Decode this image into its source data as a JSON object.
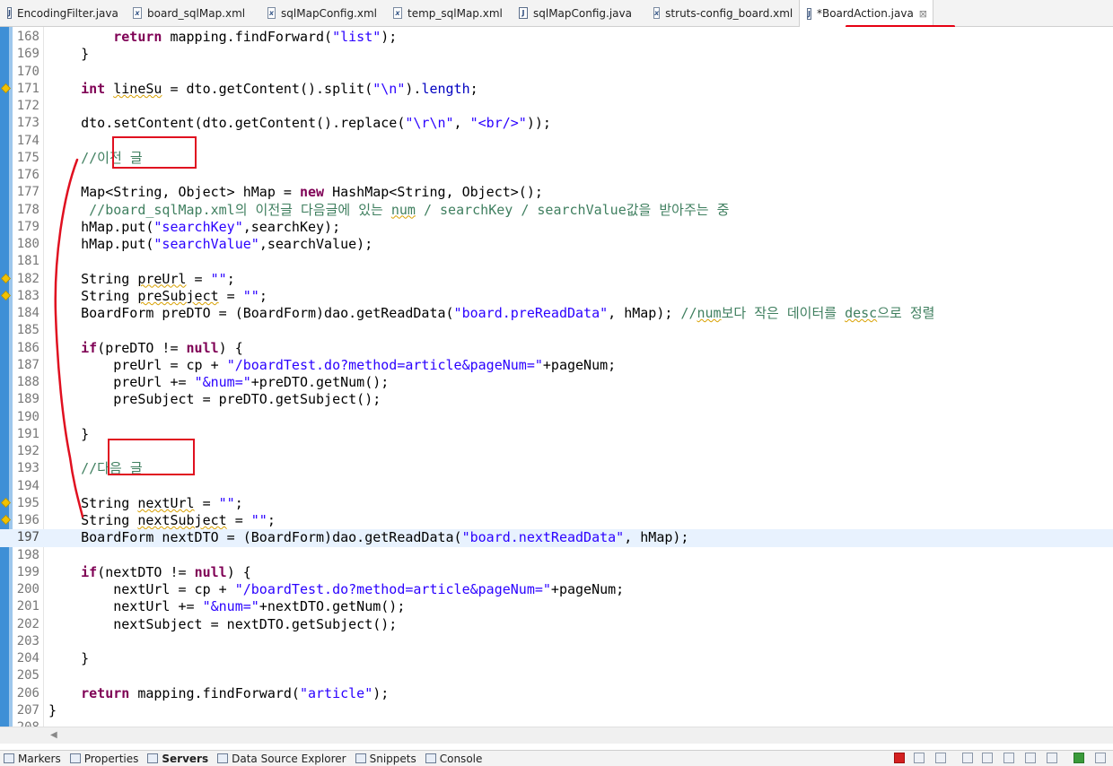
{
  "tabs": [
    {
      "label": "EncodingFilter.java",
      "kind": "java"
    },
    {
      "label": "board_sqlMap.xml",
      "kind": "xml"
    },
    {
      "label": "sqlMapConfig.xml",
      "kind": "xml"
    },
    {
      "label": "temp_sqlMap.xml",
      "kind": "xml"
    },
    {
      "label": "sqlMapConfig.java",
      "kind": "java"
    },
    {
      "label": "struts-config_board.xml",
      "kind": "xml"
    },
    {
      "label": "*BoardAction.java",
      "kind": "java",
      "active": true
    }
  ],
  "editor": {
    "current_line": 197,
    "lines": [
      {
        "n": "168",
        "html": "        <span class='kw'>return</span> mapping.findForward(<span class='str'>\"list\"</span>);"
      },
      {
        "n": "169",
        "html": "    }"
      },
      {
        "n": "170",
        "html": ""
      },
      {
        "n": "171",
        "html": "    <span class='kw'>int</span> <span class='wav'>lineSu</span> = dto.getContent().split(<span class='str'>\"\\n\"</span>).<span class='fld'>length</span>;",
        "warn": true
      },
      {
        "n": "172",
        "html": ""
      },
      {
        "n": "173",
        "html": "    dto.setContent(dto.getContent().replace(<span class='str'>\"\\r\\n\"</span>, <span class='str'>\"&lt;br/&gt;\"</span>));"
      },
      {
        "n": "174",
        "html": ""
      },
      {
        "n": "175",
        "html": "    <span class='cm'>//이전 글</span>"
      },
      {
        "n": "176",
        "html": ""
      },
      {
        "n": "177",
        "html": "    Map&lt;String, Object&gt; hMap = <span class='kw'>new</span> HashMap&lt;String, Object&gt;();"
      },
      {
        "n": "178",
        "html": "     <span class='cm'>//board_sqlMap.xml의 이전글 다음글에 있는 <span class='wav'>num</span> / searchKey / searchValue값을 받아주는 중</span>"
      },
      {
        "n": "179",
        "html": "    hMap.put(<span class='str'>\"searchKey\"</span>,searchKey);"
      },
      {
        "n": "180",
        "html": "    hMap.put(<span class='str'>\"searchValue\"</span>,searchValue);"
      },
      {
        "n": "181",
        "html": ""
      },
      {
        "n": "182",
        "html": "    String <span class='wav'>preUrl</span> = <span class='str'>\"\"</span>;",
        "warn": true
      },
      {
        "n": "183",
        "html": "    String <span class='wav'>preSubject</span> = <span class='str'>\"\"</span>;",
        "warn": true
      },
      {
        "n": "184",
        "html": "    BoardForm preDTO = (BoardForm)dao.getReadData(<span class='str'>\"board.preReadData\"</span>, hMap); <span class='cm'>//<span class='wav'>num</span>보다 작은 데이터를 <span class='wav'>desc</span>으로 정렬</span>"
      },
      {
        "n": "185",
        "html": ""
      },
      {
        "n": "186",
        "html": "    <span class='kw'>if</span>(preDTO != <span class='kw'>null</span>) {"
      },
      {
        "n": "187",
        "html": "        preUrl = cp + <span class='str'>\"/boardTest.do?method=article&amp;pageNum=\"</span>+pageNum;"
      },
      {
        "n": "188",
        "html": "        preUrl += <span class='str'>\"&amp;num=\"</span>+preDTO.getNum();"
      },
      {
        "n": "189",
        "html": "        preSubject = preDTO.getSubject();"
      },
      {
        "n": "190",
        "html": ""
      },
      {
        "n": "191",
        "html": "    }"
      },
      {
        "n": "192",
        "html": ""
      },
      {
        "n": "193",
        "html": "    <span class='cm'>//다음 글</span>"
      },
      {
        "n": "194",
        "html": ""
      },
      {
        "n": "195",
        "html": "    String <span class='wav'>nextUrl</span> = <span class='str'>\"\"</span>;",
        "warn": true
      },
      {
        "n": "196",
        "html": "    String <span class='wav'>nextSubject</span> = <span class='str'>\"\"</span>;",
        "warn": true
      },
      {
        "n": "197",
        "html": "    BoardForm nextDTO = (BoardForm)dao.getReadData(<span class='str'>\"board.nextReadData\"</span>, hMap);",
        "current": true
      },
      {
        "n": "198",
        "html": ""
      },
      {
        "n": "199",
        "html": "    <span class='kw'>if</span>(nextDTO != <span class='kw'>null</span>) {"
      },
      {
        "n": "200",
        "html": "        nextUrl = cp + <span class='str'>\"/boardTest.do?method=article&amp;pageNum=\"</span>+pageNum;"
      },
      {
        "n": "201",
        "html": "        nextUrl += <span class='str'>\"&amp;num=\"</span>+nextDTO.getNum();"
      },
      {
        "n": "202",
        "html": "        nextSubject = nextDTO.getSubject();"
      },
      {
        "n": "203",
        "html": ""
      },
      {
        "n": "204",
        "html": "    }"
      },
      {
        "n": "205",
        "html": ""
      },
      {
        "n": "206",
        "html": "    <span class='kw'>return</span> mapping.findForward(<span class='str'>\"article\"</span>);"
      },
      {
        "n": "207",
        "html": "}"
      },
      {
        "n": "208",
        "html": ""
      }
    ]
  },
  "bottom_tabs": [
    {
      "label": "Markers",
      "bold": false
    },
    {
      "label": "Properties",
      "bold": false
    },
    {
      "label": "Servers",
      "bold": true
    },
    {
      "label": "Data Source Explorer",
      "bold": false
    },
    {
      "label": "Snippets",
      "bold": false
    },
    {
      "label": "Console",
      "bold": false
    }
  ],
  "colors": {
    "annotation": "#e01020",
    "keyword": "#7f0055",
    "string": "#2a00ff",
    "comment": "#3f7f5f"
  }
}
